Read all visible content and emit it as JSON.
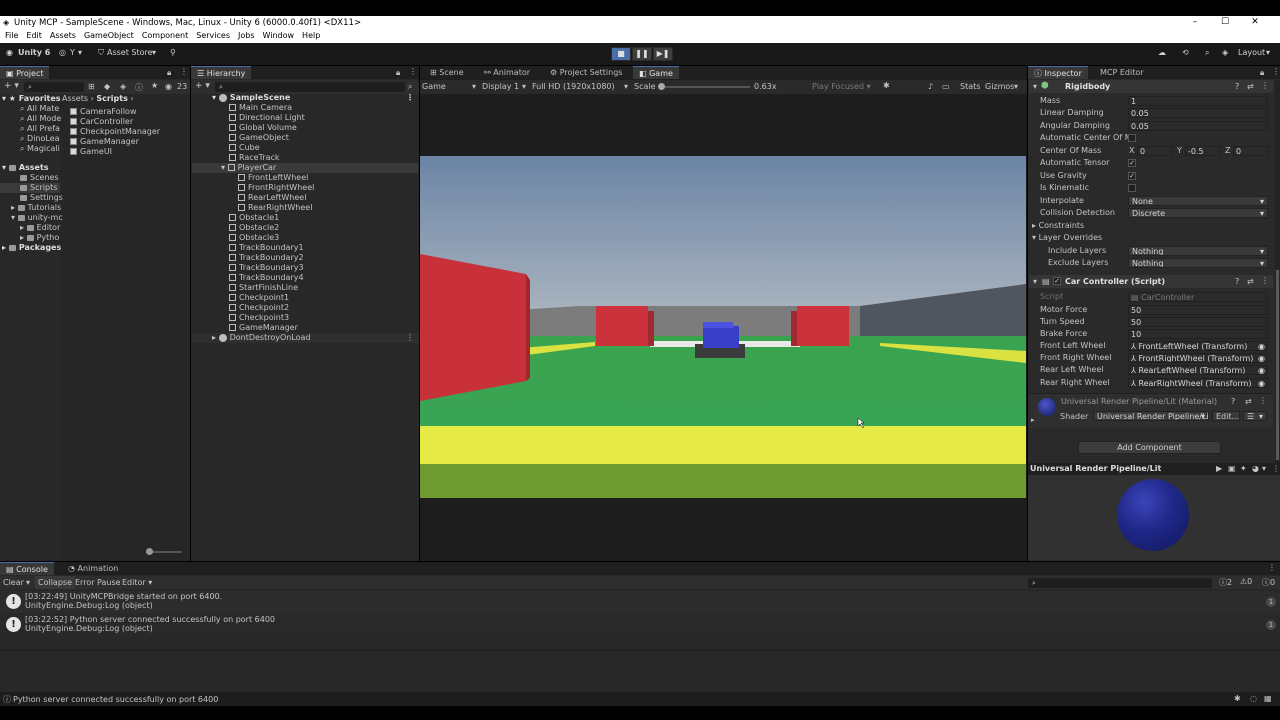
{
  "window": {
    "title": "Unity MCP - SampleScene - Windows, Mac, Linux - Unity 6 (6000.0.40f1) <DX11>",
    "controls": [
      "–",
      "☐",
      "✕"
    ]
  },
  "menu": [
    "File",
    "Edit",
    "Assets",
    "GameObject",
    "Component",
    "Services",
    "Jobs",
    "Window",
    "Help"
  ],
  "toolbar": {
    "account": "Unity 6",
    "user": "Y",
    "asset_store": "Asset Store",
    "layout": "Layout"
  },
  "project": {
    "tab": "Project",
    "count": "23",
    "breadcrumb_root": "Assets",
    "breadcrumb_sep": "›",
    "breadcrumb_current": "Scripts",
    "tree": {
      "favorites": "Favorites",
      "fav_items": [
        "All Mate",
        "All Mode",
        "All Prefa",
        "DinoLea",
        "Magicali"
      ],
      "assets": "Assets",
      "asset_items": [
        "Scenes",
        "Scripts",
        "Settings",
        "Tutorials",
        "unity-mc",
        "Editor",
        "Pytho"
      ],
      "packages": "Packages"
    },
    "files": [
      "CameraFollow",
      "CarController",
      "CheckpointManager",
      "GameManager",
      "GameUI"
    ]
  },
  "hierarchy": {
    "tab": "Hierarchy",
    "scene": "SampleScene",
    "items": [
      "Main Camera",
      "Directional Light",
      "Global Volume",
      "GameObject",
      "Cube",
      "RaceTrack",
      "PlayerCar",
      "FrontLeftWheel",
      "FrontRightWheel",
      "RearLeftWheel",
      "RearRightWheel",
      "Obstacle1",
      "Obstacle2",
      "Obstacle3",
      "TrackBoundary1",
      "TrackBoundary2",
      "TrackBoundary3",
      "TrackBoundary4",
      "StartFinishLine",
      "Checkpoint1",
      "Checkpoint2",
      "Checkpoint3",
      "GameManager"
    ],
    "dont_destroy": "DontDestroyOnLoad"
  },
  "center": {
    "tabs": [
      "Scene",
      "Animator",
      "Project Settings",
      "Game"
    ],
    "game_mode": "Game",
    "display": "Display 1",
    "resolution": "Full HD (1920x1080)",
    "scale_label": "Scale",
    "scale_value": "0.63x",
    "play_focused": "Play Focused",
    "stats": "Stats",
    "gizmos": "Gizmos"
  },
  "inspector": {
    "tabs": [
      "Inspector",
      "MCP Editor"
    ],
    "rigidbody": {
      "title": "Rigidbody",
      "mass_label": "Mass",
      "mass": "1",
      "linear_damping_label": "Linear Damping",
      "linear_damping": "0.05",
      "angular_damping_label": "Angular Damping",
      "angular_damping": "0.05",
      "auto_com_label": "Automatic Center Of Mas",
      "com_label": "Center Of Mass",
      "com_x_label": "X",
      "com_x": "0",
      "com_y_label": "Y",
      "com_y": "-0.5",
      "com_z_label": "Z",
      "com_z": "0",
      "auto_tensor_label": "Automatic Tensor",
      "use_gravity_label": "Use Gravity",
      "is_kinematic_label": "Is Kinematic",
      "interpolate_label": "Interpolate",
      "interpolate": "None",
      "collision_label": "Collision Detection",
      "collision": "Discrete",
      "constraints_label": "Constraints",
      "layer_overrides_label": "Layer Overrides",
      "include_label": "Include Layers",
      "include": "Nothing",
      "exclude_label": "Exclude Layers",
      "exclude": "Nothing"
    },
    "car_controller": {
      "title": "Car Controller (Script)",
      "script_label": "Script",
      "script": "CarController",
      "motor_label": "Motor Force",
      "motor": "50",
      "turn_label": "Turn Speed",
      "turn": "50",
      "brake_label": "Brake Force",
      "brake": "10",
      "fl_label": "Front Left Wheel",
      "fl": "FrontLeftWheel (Transform)",
      "fr_label": "Front Right Wheel",
      "fr": "FrontRightWheel (Transform)",
      "rl_label": "Rear Left Wheel",
      "rl": "RearLeftWheel (Transform)",
      "rr_label": "Rear Right Wheel",
      "rr": "RearRightWheel (Transform)"
    },
    "material": {
      "title": "Universal Render Pipeline/Lit (Material)",
      "shader_label": "Shader",
      "shader": "Universal Render Pipeline/Lit",
      "edit": "Edit...",
      "list_icon": "☰"
    },
    "add_component": "Add Component",
    "preview_title": "Universal Render Pipeline/Lit"
  },
  "console": {
    "tabs": [
      "Console",
      "Animation"
    ],
    "clear": "Clear",
    "collapse": "Collapse",
    "error_pause": "Error Pause",
    "editor": "Editor",
    "info_count": "2",
    "warn_count": "0",
    "error_count": "0",
    "logs": [
      {
        "line1": "[03:22:49] UnityMCPBridge started on port 6400.",
        "line2": "UnityEngine.Debug:Log (object)",
        "count": "1"
      },
      {
        "line1": "[03:22:52] Python server connected successfully on port 6400",
        "line2": "UnityEngine.Debug:Log (object)",
        "count": "1"
      }
    ]
  },
  "status_bar": "Python server connected successfully on port 6400",
  "colors": {
    "accent": "#4a6da8",
    "selection": "#46607c",
    "sky_top": "#6d85a5",
    "grass": "#3ba655",
    "yellow_line": "#e6ea45",
    "red_block": "#c7323b",
    "car_blue": "#3b3fc8",
    "sphere": "#222a8c"
  }
}
